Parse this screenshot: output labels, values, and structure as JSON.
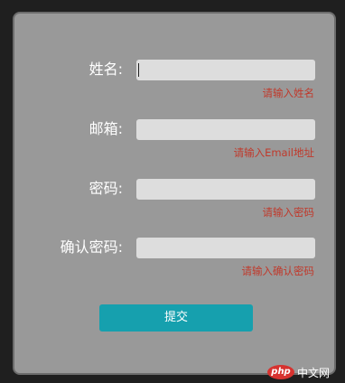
{
  "form": {
    "fields": [
      {
        "label": "姓名:",
        "value": "",
        "hint": "请输入姓名"
      },
      {
        "label": "邮箱:",
        "value": "",
        "hint": "请输入Email地址"
      },
      {
        "label": "密码:",
        "value": "",
        "hint": "请输入密码"
      },
      {
        "label": "确认密码:",
        "value": "",
        "hint": "请输入确认密码"
      }
    ],
    "submit_label": "提交"
  },
  "watermark": {
    "badge": "php",
    "text": "中文网"
  },
  "colors": {
    "panel_background": "#999999",
    "input_background": "#dddddd",
    "hint_text": "#c0392b",
    "submit_button": "#16a0ae"
  }
}
